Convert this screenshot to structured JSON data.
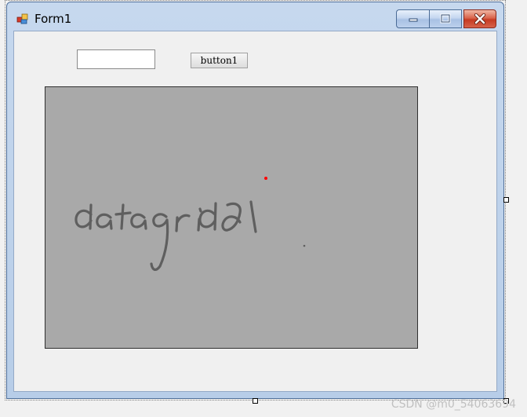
{
  "window": {
    "title": "Form1",
    "icon": "winforms-app-icon"
  },
  "caption_buttons": {
    "minimize_icon": "minimize-icon",
    "maximize_icon": "maximize-icon",
    "close_icon": "close-icon"
  },
  "form": {
    "textbox1": {
      "value": "",
      "placeholder": ""
    },
    "button1": {
      "label": "button1"
    },
    "picturebox1": {
      "background_color": "#a9a9a9",
      "handwriting_description_icon": "handwriting-datagrid-image",
      "marker_color": "#ff0000"
    }
  },
  "watermark": {
    "text": "CSDN @m0_54063694"
  }
}
